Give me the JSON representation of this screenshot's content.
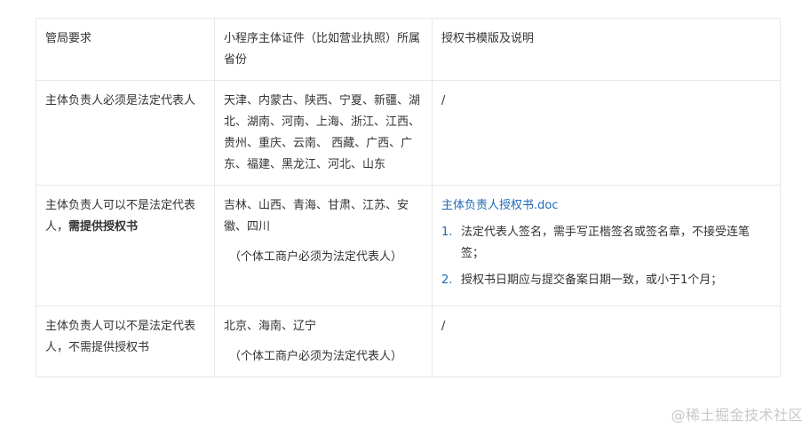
{
  "table": {
    "headers": [
      "管局要求",
      "小程序主体证件（比如营业执照）所属省份",
      "授权书模版及说明"
    ],
    "rows": [
      {
        "requirement": "主体负责人必须是法定代表人",
        "provinces": "天津、内蒙古、陕西、宁夏、新疆、湖北、湖南、河南、上海、浙江、江西、贵州、重庆、云南、 西藏、广西、广东、福建、黑龙江、河北、山东",
        "template": "/"
      },
      {
        "requirement_prefix": "主体负责人可以不是法定代表人，",
        "requirement_bold": "需提供授权书",
        "provinces": "吉林、山西、青海、甘肃、江苏、安徽、四川",
        "note": "（个体工商户必须为法定代表人）",
        "template_link": "主体负责人授权书.doc",
        "template_items": [
          {
            "num": "1.",
            "text": "法定代表人签名，需手写正楷签名或签名章，不接受连笔签；"
          },
          {
            "num": "2.",
            "text": "授权书日期应与提交备案日期一致，或小于1个月；"
          }
        ]
      },
      {
        "requirement": "主体负责人可以不是法定代表人，不需提供授权书",
        "provinces": "北京、海南、辽宁",
        "note": "（个体工商户必须为法定代表人）",
        "template": "/"
      }
    ]
  },
  "watermark": "@稀土掘金技术社区",
  "colors": {
    "link": "#1e6bb8",
    "border": "#e8e8e8",
    "text": "#333333"
  }
}
